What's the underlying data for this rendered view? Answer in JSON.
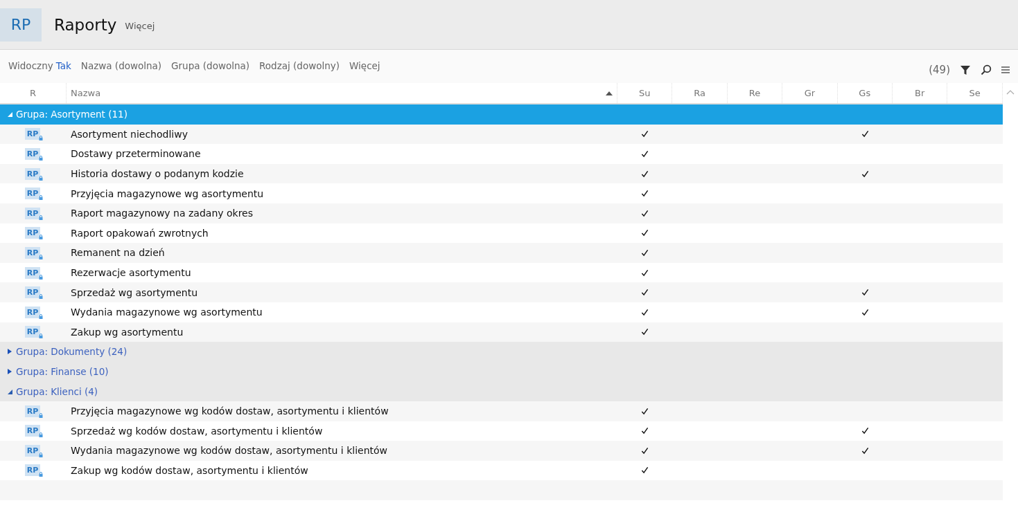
{
  "header": {
    "logo": "RP",
    "title": "Raporty",
    "more": "Więcej"
  },
  "filters": [
    {
      "label": "Widoczny",
      "value": "Tak"
    },
    {
      "label": "Nazwa (dowolna)"
    },
    {
      "label": "Grupa (dowolna)"
    },
    {
      "label": "Rodzaj (dowolny)"
    },
    {
      "label": "Więcej"
    }
  ],
  "count": "(49)",
  "table": {
    "columns": [
      "R",
      "Nazwa",
      "Su",
      "Ra",
      "Re",
      "Gr",
      "Gs",
      "Br",
      "Se"
    ],
    "groups": [
      {
        "label": "Grupa: Asortyment (11)",
        "selected": true,
        "expanded": true,
        "rows": [
          {
            "badge": "RP",
            "name": "Asortyment niechodliwy",
            "su": true,
            "gs": true
          },
          {
            "badge": "RP",
            "name": "Dostawy przeterminowane",
            "su": true,
            "gs": false
          },
          {
            "badge": "RP",
            "name": "Historia dostawy o podanym kodzie",
            "su": true,
            "gs": true
          },
          {
            "badge": "RP",
            "name": "Przyjęcia magazynowe wg asortymentu",
            "su": true,
            "gs": false
          },
          {
            "badge": "RP",
            "name": "Raport magazynowy na zadany okres",
            "su": true,
            "gs": false
          },
          {
            "badge": "RP",
            "name": "Raport opakowań zwrotnych",
            "su": true,
            "gs": false
          },
          {
            "badge": "RP",
            "name": "Remanent na dzień",
            "su": true,
            "gs": false
          },
          {
            "badge": "RP",
            "name": "Rezerwacje asortymentu",
            "su": true,
            "gs": false
          },
          {
            "badge": "RP",
            "name": "Sprzedaż wg asortymentu",
            "su": true,
            "gs": true
          },
          {
            "badge": "RP",
            "name": "Wydania magazynowe wg asortymentu",
            "su": true,
            "gs": true
          },
          {
            "badge": "RP",
            "name": "Zakup wg asortymentu",
            "su": true,
            "gs": false
          }
        ]
      },
      {
        "label": "Grupa: Dokumenty (24)",
        "selected": false,
        "expanded": false
      },
      {
        "label": "Grupa: Finanse (10)",
        "selected": false,
        "expanded": false
      },
      {
        "label": "Grupa: Klienci (4)",
        "selected": false,
        "expanded": true,
        "rows": [
          {
            "badge": "RP",
            "name": "Przyjęcia magazynowe wg kodów dostaw, asortymentu i klientów",
            "su": true,
            "gs": false
          },
          {
            "badge": "RP",
            "name": "Sprzedaż wg kodów dostaw, asortymentu i klientów",
            "su": true,
            "gs": true
          },
          {
            "badge": "RP",
            "name": "Wydania magazynowe wg kodów dostaw, asortymentu i klientów",
            "su": true,
            "gs": true
          },
          {
            "badge": "RP",
            "name": "Zakup wg kodów dostaw, asortymentu i klientów",
            "su": true,
            "gs": false
          }
        ]
      }
    ]
  }
}
